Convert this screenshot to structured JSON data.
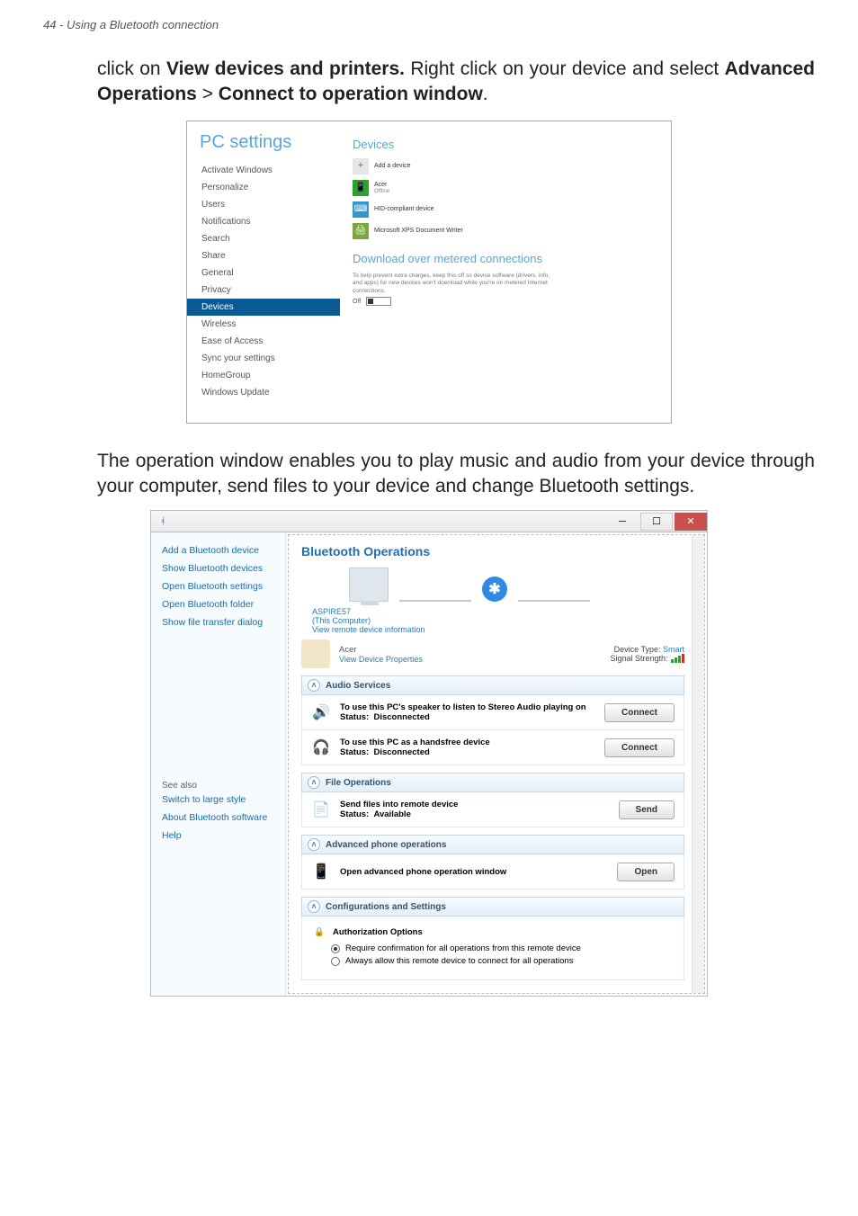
{
  "header": "44 - Using a Bluetooth connection",
  "para1": {
    "t1": "click on ",
    "b1": "View devices and printers.",
    "t2": " Right click on your device and select ",
    "b2": "Advanced Operations",
    "t3": " > ",
    "b3": "Connect to operation window",
    "t4": "."
  },
  "para2": "The operation window enables you to play music and audio from your device through your computer, send files to your device and change Bluetooth settings.",
  "pc": {
    "title": "PC settings",
    "nav": [
      "Activate Windows",
      "Personalize",
      "Users",
      "Notifications",
      "Search",
      "Share",
      "General",
      "Privacy",
      "Devices",
      "Wireless",
      "Ease of Access",
      "Sync your settings",
      "HomeGroup",
      "Windows Update"
    ],
    "selected": "Devices",
    "devices_heading": "Devices",
    "add_label": "Add a device",
    "dev1_name": "Acer",
    "dev1_status": "Offline",
    "dev2_name": "HID-compliant device",
    "dev3_name": "Microsoft XPS Document Writer",
    "dl_heading": "Download over metered connections",
    "dl_text": "To help prevent extra charges, keep this off so device software (drivers, info, and apps) for new devices won't download while you're on metered Internet connections.",
    "toggle_label": "Off"
  },
  "bt": {
    "side_items": [
      "Add a Bluetooth device",
      "Show Bluetooth devices",
      "Open Bluetooth settings",
      "Open Bluetooth folder",
      "Show file transfer dialog"
    ],
    "see_also": "See also",
    "side_items2": [
      "Switch to large style",
      "About Bluetooth software",
      "Help"
    ],
    "title": "Bluetooth Operations",
    "computer_name": "ASPIRE57",
    "computer_sub": "(This Computer)",
    "view_remote": "View remote device information",
    "dev_name": "Acer",
    "view_props": "View Device Properties",
    "type_label": "Device Type:",
    "type_value": "Smart",
    "signal_label": "Signal Strength:",
    "sec_audio": "Audio Services",
    "audio1_line": "To use this PC's speaker to listen to Stereo Audio playing on",
    "audio1_status_k": "Status:",
    "audio1_status_v": "Disconnected",
    "audio2_line": "To use this PC as a handsfree device",
    "audio2_status_v": "Disconnected",
    "btn_connect": "Connect",
    "sec_file": "File Operations",
    "file_line": "Send files into remote device",
    "file_status_v": "Available",
    "btn_send": "Send",
    "sec_phone": "Advanced phone operations",
    "phone_line": "Open advanced phone operation window",
    "btn_open": "Open",
    "sec_cfg": "Configurations and Settings",
    "cfg_heading": "Authorization Options",
    "cfg_opt1": "Require confirmation for all operations from this remote device",
    "cfg_opt2": "Always allow this remote device to connect for all operations"
  }
}
